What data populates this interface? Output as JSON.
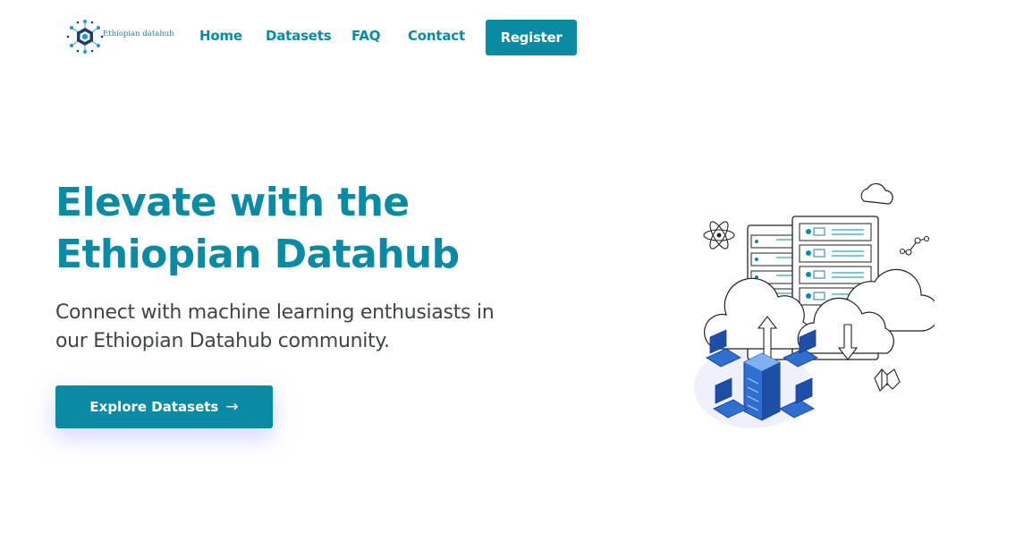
{
  "brand": {
    "name": "Ethiopian datahub",
    "logo_icon": "hexagon-network-icon"
  },
  "nav": {
    "items": [
      {
        "label": "Home"
      },
      {
        "label": "Datasets"
      },
      {
        "label": "FAQ"
      },
      {
        "label": "Contact"
      }
    ],
    "register_label": "Register"
  },
  "hero": {
    "title_line1": "Elevate with the",
    "title_line2": "Ethiopian Datahub",
    "subtitle_line1": "Connect with machine learning enthusiasts in",
    "subtitle_line2": "our Ethiopian Datahub community.",
    "cta_label": "Explore Datasets",
    "cta_icon": "arrow-right-icon"
  },
  "illustration": {
    "icon": "cloud-servers-illustration"
  },
  "colors": {
    "accent": "#0b8ba3",
    "text": "#3f4447",
    "background": "#ffffff"
  }
}
